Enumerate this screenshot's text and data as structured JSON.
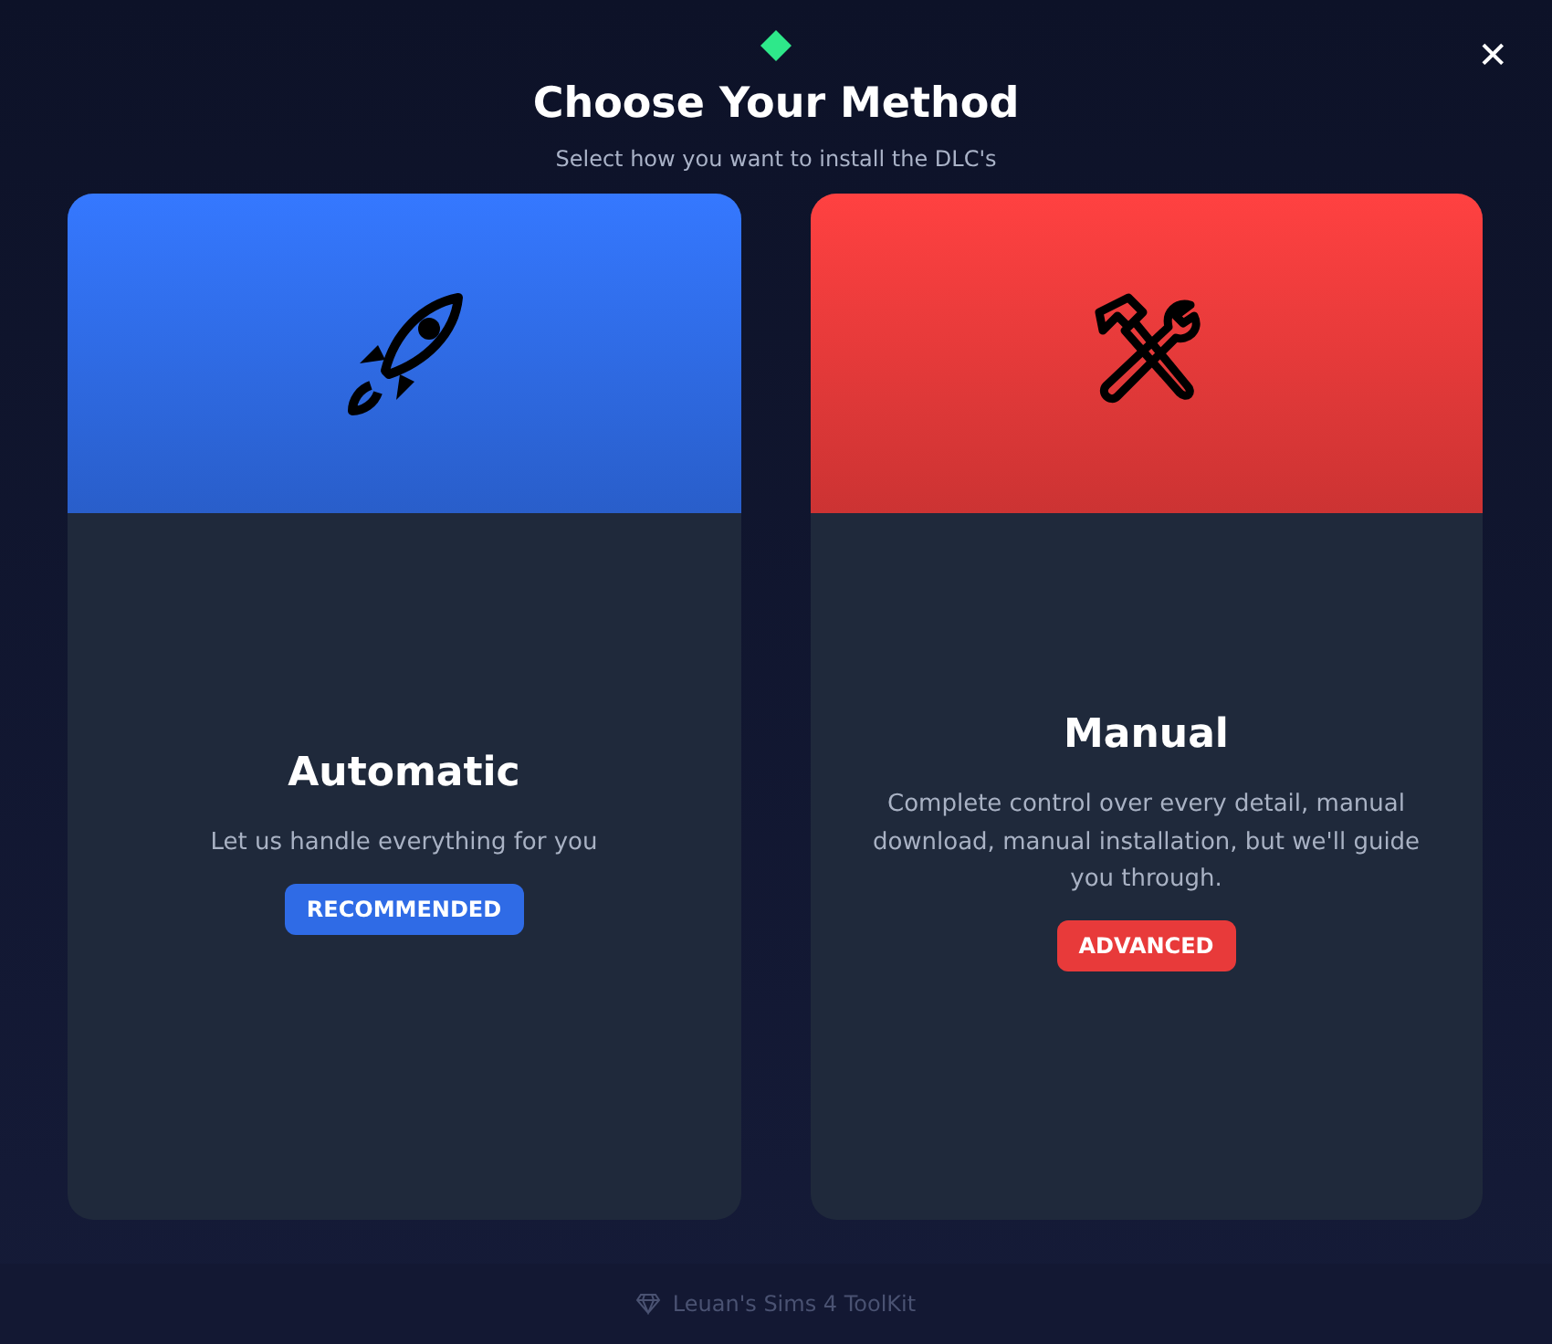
{
  "close_label": "✕",
  "title": "Choose Your Method",
  "subtitle": "Select how you want to install the DLC's",
  "cards": [
    {
      "kind": "rocket",
      "name": "Automatic",
      "description": "Let us handle everything for you",
      "badge": "RECOMMENDED",
      "color": "#2f6be6"
    },
    {
      "kind": "tools",
      "name": "Manual",
      "description": "Complete control over every detail, manual download, manual installation, but we'll guide you through.",
      "badge": "ADVANCED",
      "color": "#e83a3a"
    }
  ],
  "footer": "Leuan's Sims 4 ToolKit"
}
